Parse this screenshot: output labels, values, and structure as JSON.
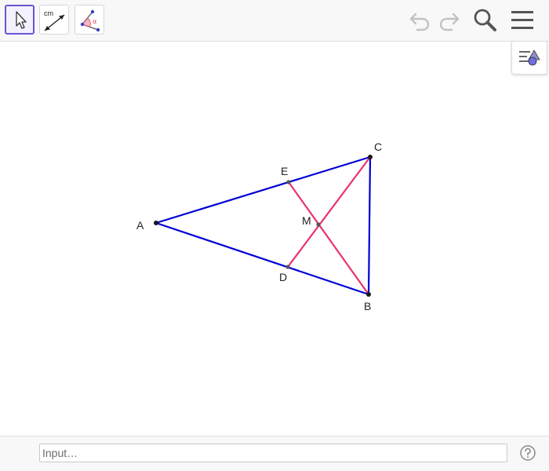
{
  "toolbar": {
    "tools": [
      {
        "name": "move",
        "selected": true
      },
      {
        "name": "distance-or-length",
        "label": "cm",
        "selected": false
      },
      {
        "name": "angle",
        "label": "α",
        "selected": false
      }
    ],
    "actions": [
      "undo-icon",
      "redo-icon",
      "search-icon",
      "menu-icon"
    ],
    "accent_color": "#6557d2"
  },
  "graphics": {
    "points": [
      {
        "id": "A",
        "label": "A"
      },
      {
        "id": "B",
        "label": "B"
      },
      {
        "id": "C",
        "label": "C"
      },
      {
        "id": "D",
        "label": "D"
      },
      {
        "id": "E",
        "label": "E"
      },
      {
        "id": "M",
        "label": "M"
      }
    ],
    "segments": [
      {
        "from": "A",
        "to": "C",
        "color": "#0000d6"
      },
      {
        "from": "A",
        "to": "B",
        "color": "#0000d6"
      },
      {
        "from": "C",
        "to": "B",
        "color": "#0000d6"
      },
      {
        "from": "E",
        "to": "B",
        "color": "#e8336a"
      },
      {
        "from": "D",
        "to": "C",
        "color": "#e8336a"
      }
    ]
  },
  "input_bar": {
    "placeholder": "Input…"
  },
  "colors": {
    "triangle": "#0000d6",
    "cevians": "#e8336a",
    "point": "#1a1a1a"
  }
}
